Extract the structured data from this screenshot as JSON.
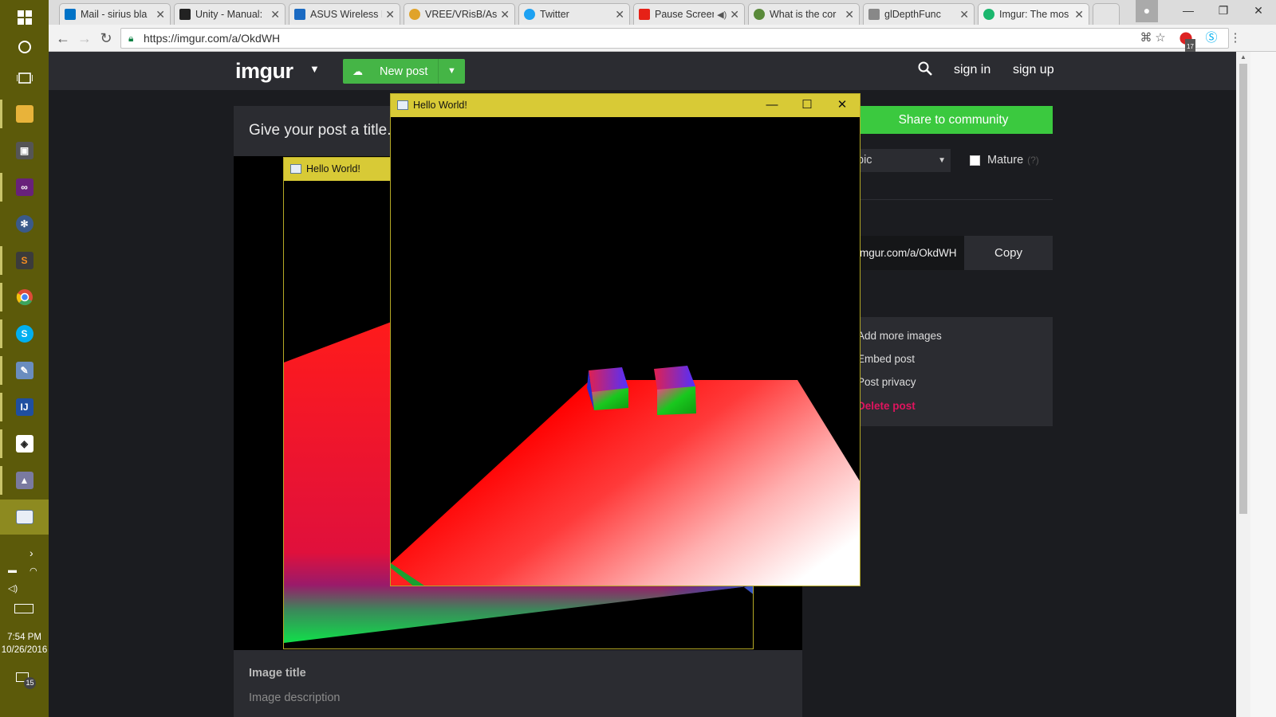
{
  "taskbar": {
    "apps": [
      {
        "name": "windows-start-icon",
        "glyph": "⊞"
      },
      {
        "name": "cortana-icon",
        "glyph": "○"
      },
      {
        "name": "task-view-icon",
        "glyph": "▭"
      },
      {
        "name": "file-explorer-icon",
        "color": "#e8b33a"
      },
      {
        "name": "store-icon",
        "color": "#555555"
      },
      {
        "name": "visual-studio-icon",
        "color": "#68217a"
      },
      {
        "name": "app-icon",
        "color": "#3a5a8a"
      },
      {
        "name": "sublime-text-icon",
        "color": "#f58d21"
      },
      {
        "name": "chrome-icon",
        "color": "#dd4b39"
      },
      {
        "name": "skype-icon",
        "color": "#00aff0"
      },
      {
        "name": "paint-icon",
        "color": "#6a8dbf"
      },
      {
        "name": "intellij-icon",
        "color": "#1f4fa0"
      },
      {
        "name": "unity-icon",
        "color": "#222222"
      },
      {
        "name": "app-icon",
        "color": "#7a7aa0"
      },
      {
        "name": "hello-world-app-icon",
        "color": "#e9eef6"
      }
    ],
    "clock_time": "7:54 PM",
    "clock_date": "10/26/2016",
    "notification_count": "15"
  },
  "browser": {
    "tabs": [
      {
        "title": "Mail - sirius bla",
        "fav_color": "#0072c6"
      },
      {
        "title": "Unity - Manual:",
        "fav_color": "#222222"
      },
      {
        "title": "ASUS Wireless F",
        "fav_color": "#1a6ac2"
      },
      {
        "title": "VREE/VRisB/Ass",
        "fav_color": "#e0a32a"
      },
      {
        "title": "Twitter",
        "fav_color": "#1da1f2"
      },
      {
        "title": "Pause Screen",
        "fav_color": "#e62117"
      },
      {
        "title": "What is the cor",
        "fav_color": "#5a8a3a"
      },
      {
        "title": "glDepthFunc",
        "fav_color": "#888888"
      },
      {
        "title": "Imgur: The mos",
        "fav_color": "#1bb76e"
      }
    ],
    "url": "https://imgur.com/a/OkdWH",
    "ext_badge": "17"
  },
  "imgur": {
    "logo": "imgur",
    "new_post": "New post",
    "sign_in": "sign in",
    "sign_up": "sign up",
    "post_title_placeholder": "Give your post a title...",
    "image_title": "Image title",
    "image_description": "Image description",
    "share": "Share to community",
    "topic": "pic",
    "mature": "Mature",
    "mature_help": "(?)",
    "link": "imgur.com/a/OkdWH",
    "copy": "Copy",
    "menu": [
      "Add more images",
      "Embed post",
      "Post privacy",
      "Delete post"
    ]
  },
  "native_windows": [
    {
      "title": "Hello World!"
    },
    {
      "title": "Hello World!"
    }
  ],
  "colors": {
    "taskbar": "#5c5a0a",
    "imgur_green": "#45b546",
    "share_green": "#3bc93f",
    "native_titlebar": "#d8ca36",
    "delete_red": "#e0145e"
  }
}
